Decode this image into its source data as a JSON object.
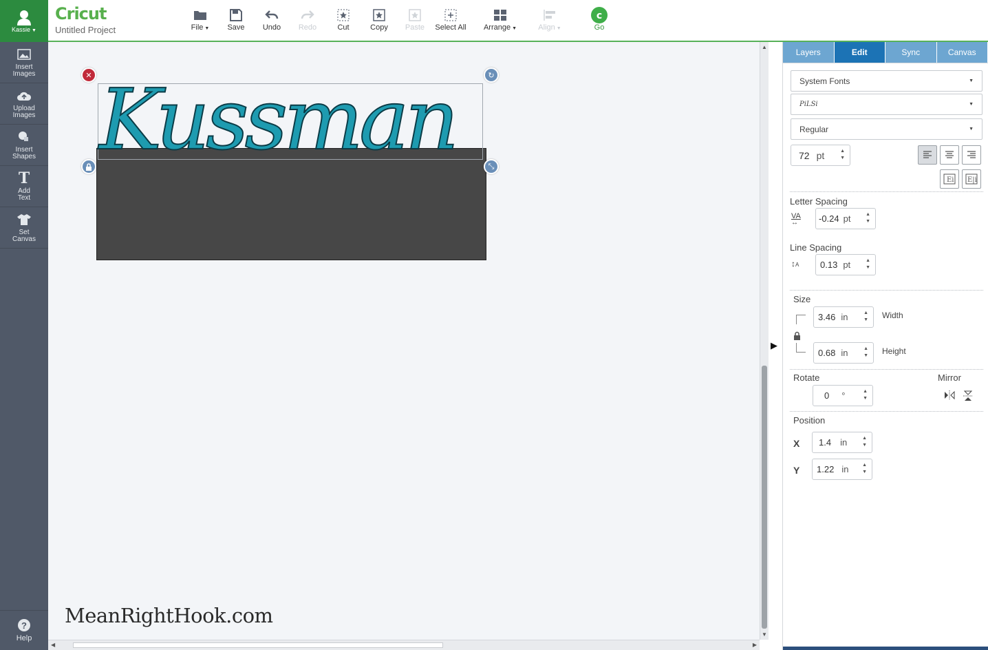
{
  "user": {
    "name": "Kassie"
  },
  "sidebar": {
    "items": [
      {
        "label_1": "Insert",
        "label_2": "Images"
      },
      {
        "label_1": "Upload",
        "label_2": "Images"
      },
      {
        "label_1": "Insert",
        "label_2": "Shapes"
      },
      {
        "label_1": "Add",
        "label_2": "Text"
      },
      {
        "label_1": "Set",
        "label_2": "Canvas"
      }
    ],
    "help": "Help"
  },
  "header": {
    "logo": "Cricut",
    "project": "Untitled Project",
    "toolbar": {
      "file": "File",
      "save": "Save",
      "undo": "Undo",
      "redo": "Redo",
      "cut": "Cut",
      "copy": "Copy",
      "paste": "Paste",
      "select_all": "Select All",
      "arrange": "Arrange",
      "align": "Align",
      "go": "Go"
    },
    "accent": "#57b158"
  },
  "canvas": {
    "text": "Kussman",
    "text_color": "#1e9bb0",
    "watermark": "MeanRightHook.com"
  },
  "panel": {
    "tabs": [
      "Layers",
      "Edit",
      "Sync",
      "Canvas"
    ],
    "active_tab": "Edit",
    "font_source": "System Fonts",
    "font_name": "PiLSi",
    "font_style": "Regular",
    "font_size": {
      "value": "72",
      "unit": "pt"
    },
    "letter_spacing": {
      "label": "Letter Spacing",
      "value": "-0.24",
      "unit": "pt",
      "icon": "VA"
    },
    "line_spacing": {
      "label": "Line Spacing",
      "value": "0.13",
      "unit": "pt"
    },
    "size": {
      "label": "Size",
      "width": {
        "value": "3.46",
        "unit": "in",
        "label": "Width"
      },
      "height": {
        "value": "0.68",
        "unit": "in",
        "label": "Height"
      }
    },
    "rotate": {
      "label": "Rotate",
      "value": "0",
      "unit": "°"
    },
    "mirror": {
      "label": "Mirror"
    },
    "position": {
      "label": "Position",
      "x_label": "X",
      "x": {
        "value": "1.4",
        "unit": "in"
      },
      "y_label": "Y",
      "y": {
        "value": "1.22",
        "unit": "in"
      }
    },
    "tab_color": "#6da6d1",
    "active_tab_color": "#1c73b5"
  }
}
